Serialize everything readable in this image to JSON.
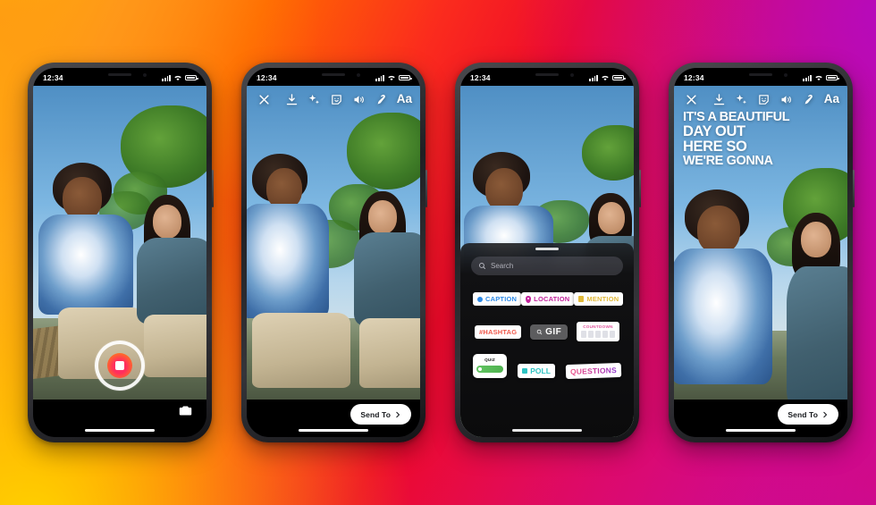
{
  "background": {
    "type": "instagram-gradient",
    "colors": [
      "#ffc800",
      "#ff9a1f",
      "#ff6a00",
      "#fb2c1d",
      "#ee0a2a",
      "#e50b4c",
      "#d70a7d",
      "#c409ae",
      "#b809c7"
    ]
  },
  "status_bar": {
    "time": "12:34",
    "signal": "signal-bars-icon",
    "wifi": "wifi-icon",
    "battery": "battery-icon"
  },
  "toolbar": {
    "close_label": "close-icon",
    "items": [
      {
        "name": "download-icon",
        "label": "Save"
      },
      {
        "name": "sparkles-icon",
        "label": "Effects"
      },
      {
        "name": "sticker-icon",
        "label": "Stickers"
      },
      {
        "name": "audio-icon",
        "label": "Audio"
      },
      {
        "name": "draw-icon",
        "label": "Draw"
      }
    ],
    "text_label": "Aa"
  },
  "phones": [
    {
      "id": "phone-capture",
      "screen": "camera-capture",
      "shutter": {
        "name": "record-button",
        "state": "recording"
      },
      "flip_camera": "flip-camera-icon"
    },
    {
      "id": "phone-preview",
      "screen": "story-preview",
      "send_to": {
        "label": "Send To",
        "chevron": "chevron-right-icon"
      }
    },
    {
      "id": "phone-stickers",
      "screen": "sticker-tray",
      "search": {
        "placeholder": "Search",
        "icon": "search-icon"
      },
      "sticker_rows": [
        [
          {
            "name": "sticker-caption",
            "label": "CAPTION",
            "color": "#2e8ae6",
            "icon": "caption-dot-icon"
          },
          {
            "name": "sticker-location",
            "label": "LOCATION",
            "color": "#c2249c",
            "icon": "location-pin-icon"
          },
          {
            "name": "sticker-mention",
            "label": "MENTION",
            "color": "#e0b93a",
            "icon": "mention-icon"
          }
        ],
        [
          {
            "name": "sticker-hashtag",
            "label": "#HASHTAG",
            "color": "#f0594b"
          },
          {
            "name": "sticker-gif",
            "label": "GIF",
            "color": "#ffffff",
            "icon": "search-icon"
          },
          {
            "name": "sticker-countdown",
            "label": "COUNTDOWN",
            "color": "#e0529c"
          }
        ],
        [
          {
            "name": "sticker-quiz",
            "label": "QUIZ",
            "color": "#1a1a1a"
          },
          {
            "name": "sticker-poll",
            "label": "POLL",
            "color": "#2ec3c3"
          },
          {
            "name": "sticker-questions",
            "label": "QUESTIONS",
            "color": "#c0349a"
          }
        ]
      ]
    },
    {
      "id": "phone-caption",
      "screen": "story-with-caption",
      "caption": {
        "line1": "IT'S A BEAUTIFUL",
        "line2": "DAY OUT",
        "line3": "HERE SO",
        "line4": "WE'RE GONNA"
      },
      "send_to": {
        "label": "Send To",
        "chevron": "chevron-right-icon"
      }
    }
  ]
}
